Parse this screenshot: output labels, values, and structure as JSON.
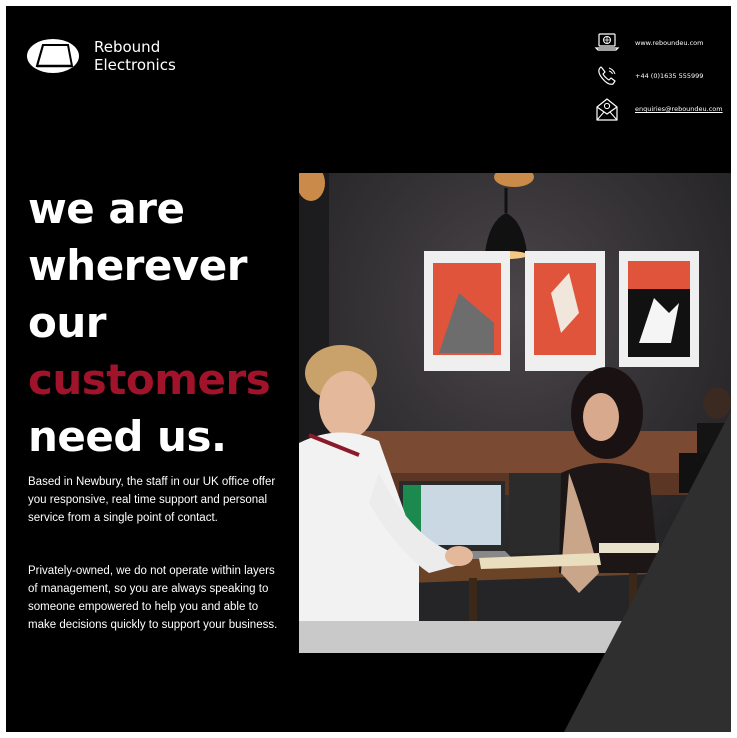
{
  "brand": {
    "line1": "Rebound",
    "line2": "Electronics",
    "logo_icon": "logo-mark-icon"
  },
  "contact": {
    "website": "www.reboundeu.com",
    "phone": "+44 (0)1635 555999",
    "email": "enquiries@reboundeu.com"
  },
  "headline": {
    "line1": "we are",
    "line2": "wherever",
    "line3": "our",
    "line4": "customers",
    "line5": "need us."
  },
  "body": {
    "p1": "Based in Newbury, the staff in our UK office offer you responsive, real time support and personal service from a single point of contact.",
    "p2": "Privately-owned, we do not operate within layers of management, so you are always speaking to someone empowered to help you and able to make decisions quickly to support your business."
  },
  "colors": {
    "background": "#000000",
    "accent": "#a1132a",
    "text": "#ffffff",
    "panel": "#2f2f2f"
  }
}
